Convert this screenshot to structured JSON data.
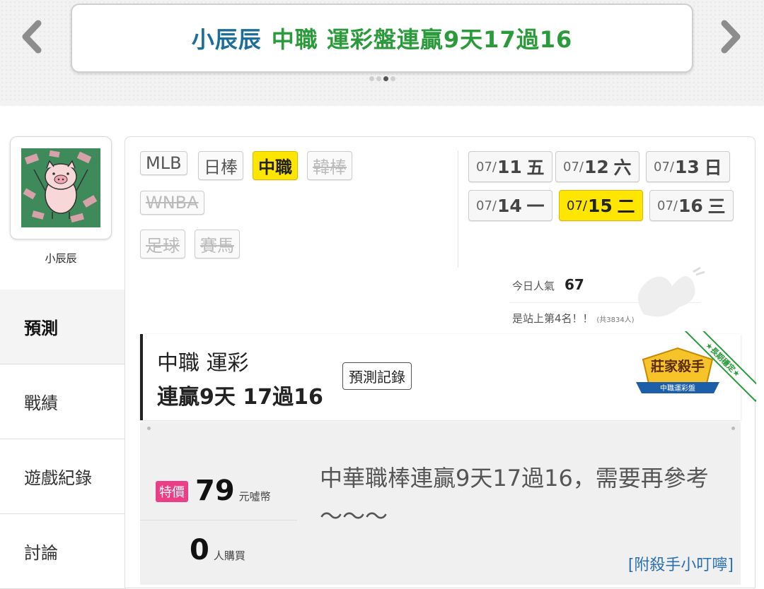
{
  "banner": {
    "name": "小辰辰",
    "headline": "中職 運彩盤連贏9天17過16",
    "slide_count": 4,
    "active_slide": 3,
    "prev_icon": "chevron-left-icon",
    "next_icon": "chevron-right-icon"
  },
  "user": {
    "name": "小辰辰"
  },
  "sidebar": {
    "items": [
      {
        "label": "預測",
        "active": true
      },
      {
        "label": "戰績",
        "active": false
      },
      {
        "label": "遊戲紀錄",
        "active": false
      },
      {
        "label": "討論",
        "active": false
      }
    ]
  },
  "categories": [
    {
      "label": "MLB",
      "state": "normal"
    },
    {
      "label": "日棒",
      "state": "normal"
    },
    {
      "label": "中職",
      "state": "selected"
    },
    {
      "label": "韓棒",
      "state": "disabled"
    },
    {
      "label": "WNBA",
      "state": "disabled"
    },
    {
      "label": "足球",
      "state": "disabled"
    },
    {
      "label": "賽馬",
      "state": "disabled"
    }
  ],
  "dates": [
    {
      "md": "07/",
      "day": "11",
      "wd": "五",
      "selected": false
    },
    {
      "md": "07/",
      "day": "12",
      "wd": "六",
      "selected": false
    },
    {
      "md": "07/",
      "day": "13",
      "wd": "日",
      "selected": false
    },
    {
      "md": "07/",
      "day": "14",
      "wd": "一",
      "selected": false
    },
    {
      "md": "07/",
      "day": "15",
      "wd": "二",
      "selected": true
    },
    {
      "md": "07/",
      "day": "16",
      "wd": "三",
      "selected": false
    }
  ],
  "stats": {
    "popularity_label": "今日人氣",
    "popularity_value": "67",
    "rank_text": "是站上第4名！！",
    "rank_total": "(共3834人)"
  },
  "prediction": {
    "line1": "中職 運彩",
    "line2": "連贏9天 17過16",
    "record_button": "預測記錄",
    "badge_title": "莊家殺手",
    "badge_sub": "中職運彩盤",
    "ribbon": "★長期穩定★"
  },
  "offer": {
    "tag": "特價",
    "price": "79",
    "price_unit": "元噓幣",
    "buyers": "0",
    "buyers_unit": "人購買",
    "description": "中華職棒連贏9天17過16，需要再參考～～～",
    "tip_link": "[附殺手小叮嚀]"
  },
  "colors": {
    "selected": "#ffe600",
    "banner_name": "#1a6e99",
    "banner_green": "#2b9a3a",
    "tag_pink": "#ea3f86",
    "link_blue": "#2a6fb0"
  }
}
